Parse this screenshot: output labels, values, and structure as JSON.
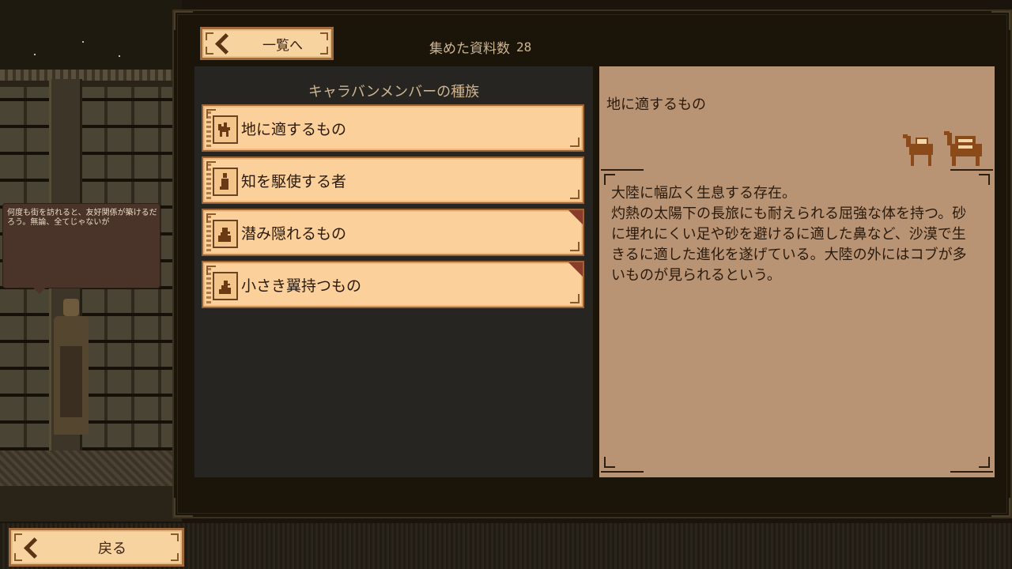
{
  "npc_dialog": {
    "text": "何度も街を訪れると、友好関係が築けるだろう。無論、全てじゃないが"
  },
  "header": {
    "back_to_list_label": "一覧へ",
    "collected_label": "集めた資料数",
    "collected_count": "28"
  },
  "list": {
    "title": "キャラバンメンバーの種族",
    "items": [
      {
        "label": "地に適するもの",
        "icon": "camel-icon",
        "selected": true,
        "new": false
      },
      {
        "label": "知を駆使する者",
        "icon": "human-icon",
        "selected": false,
        "new": false
      },
      {
        "label": "潜み隠れるもの",
        "icon": "lurker-icon",
        "selected": false,
        "new": true
      },
      {
        "label": "小さき翼持つもの",
        "icon": "bird-icon",
        "selected": false,
        "new": true
      }
    ]
  },
  "detail": {
    "title": "地に適するもの",
    "illustration": "camel-pair-icon",
    "body": "大陸に幅広く生息する存在。\n灼熱の太陽下の長旅にも耐えられる屈強な体を持つ。砂に埋れにくい足や砂を避けるに適した鼻など、沙漠で生きるに適した進化を遂げている。大陸の外にはコブが多いものが見られるという。"
  },
  "footer": {
    "back_label": "戻る"
  },
  "colors": {
    "item_bg": "#fbd09a",
    "detail_bg": "#b99474",
    "list_bg": "#272521",
    "accent_border": "#9a6438",
    "new_flag": "#8a3c2a"
  }
}
